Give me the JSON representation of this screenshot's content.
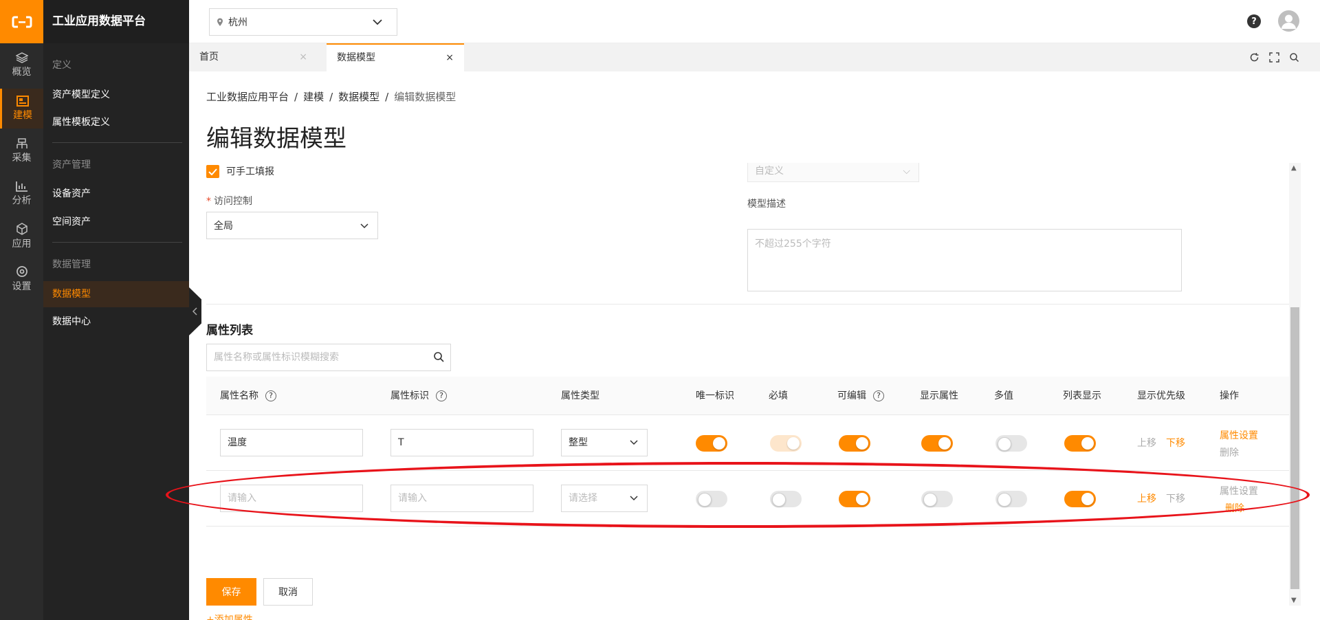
{
  "app": {
    "title": "工业应用数据平台"
  },
  "rail": [
    {
      "label": "概览",
      "icon": "layers-icon"
    },
    {
      "label": "建模",
      "icon": "model-icon"
    },
    {
      "label": "采集",
      "icon": "collect-icon"
    },
    {
      "label": "分析",
      "icon": "chart-icon"
    },
    {
      "label": "应用",
      "icon": "cube-icon"
    },
    {
      "label": "设置",
      "icon": "gear-icon"
    }
  ],
  "menu": {
    "groups": [
      {
        "title": "定义",
        "items": [
          "资产模型定义",
          "属性模板定义"
        ]
      },
      {
        "title": "资产管理",
        "items": [
          "设备资产",
          "空间资产"
        ]
      },
      {
        "title": "数据管理",
        "items": [
          "数据模型",
          "数据中心"
        ]
      }
    ],
    "active": "数据模型"
  },
  "topbar": {
    "city": "杭州",
    "help": "?"
  },
  "tabs": [
    {
      "label": "首页",
      "close": "×"
    },
    {
      "label": "数据模型",
      "close": "×"
    }
  ],
  "breadcrumb": [
    "工业数据应用平台",
    "建模",
    "数据模型",
    "编辑数据模型"
  ],
  "breadcrumb_sep": "/",
  "page": {
    "title": "编辑数据模型"
  },
  "form": {
    "manual_fill_label": "可手工填报",
    "custom_select_value": "自定义",
    "access_label": "访问控制",
    "required_mark": "*",
    "access_value": "全局",
    "desc_label": "模型描述",
    "desc_placeholder": "不超过255个字符"
  },
  "attributes": {
    "section_title": "属性列表",
    "search_placeholder": "属性名称或属性标识模糊搜索",
    "columns": [
      "属性名称",
      "属性标识",
      "属性类型",
      "唯一标识",
      "必填",
      "可编辑",
      "显示属性",
      "多值",
      "列表显示",
      "显示优先级",
      "操作"
    ],
    "help_mark": "?",
    "rows": [
      {
        "name": "温度",
        "id": "T",
        "type": "整型",
        "unique": true,
        "required": true,
        "editable": true,
        "display": true,
        "multi": false,
        "list": true,
        "up": "上移",
        "down": "下移",
        "setting": "属性设置",
        "delete": "删除"
      },
      {
        "name_placeholder": "请输入",
        "id_placeholder": "请输入",
        "type_placeholder": "请选择",
        "unique": false,
        "required": false,
        "editable": true,
        "display": false,
        "multi": false,
        "list": true,
        "up": "上移",
        "down": "下移",
        "setting": "属性设置",
        "delete": "删除"
      }
    ],
    "add_label": "+添加属性"
  },
  "actions": {
    "save": "保存",
    "cancel": "取消"
  },
  "colors": {
    "accent": "#ff8a00",
    "annotation": "#e8131a",
    "sidebar": "#232323"
  }
}
